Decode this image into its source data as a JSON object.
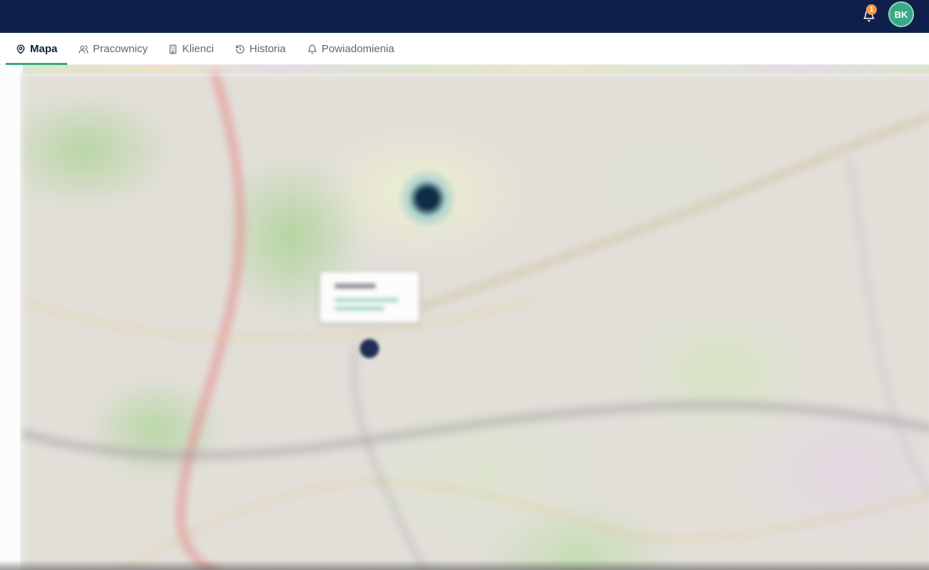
{
  "header": {
    "notifications_count": "1",
    "user_initials": "BK",
    "colors": {
      "bar": "#0f1f4b",
      "avatar": "#3aa986",
      "badge": "#f2994a"
    }
  },
  "nav": {
    "tabs": [
      {
        "label": "Mapa",
        "icon": "map-pin-icon",
        "active": true
      },
      {
        "label": "Pracownicy",
        "icon": "users-icon",
        "active": false
      },
      {
        "label": "Klienci",
        "icon": "building-icon",
        "active": false
      },
      {
        "label": "Historia",
        "icon": "history-icon",
        "active": false
      },
      {
        "label": "Powiadomienia",
        "icon": "bell-icon",
        "active": false
      }
    ],
    "accent": "#3aa986"
  },
  "map": {
    "markers": [
      {
        "kind": "location-cluster-marker"
      },
      {
        "kind": "location-marker"
      }
    ]
  }
}
